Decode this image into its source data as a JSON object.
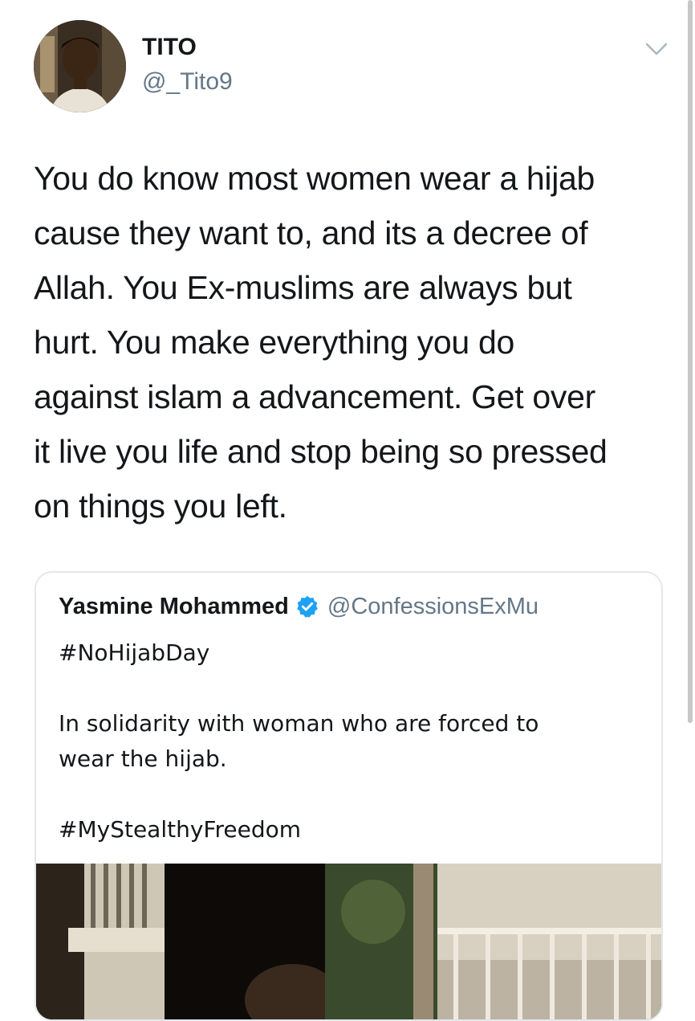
{
  "author": {
    "name": "TITO",
    "handle": "@_Tito9",
    "avatar_icon": "profile-photo"
  },
  "tweet": {
    "lines": [
      "You do know most women wear a hijab",
      "cause they want to, and its a decree of",
      "Allah. You Ex-muslims are always but",
      "hurt. You make everything you do",
      "against islam a advancement. Get over",
      "it live you life and stop being so pressed",
      "on things you left."
    ]
  },
  "quoted_tweet": {
    "name": "Yasmine Mohammed",
    "handle": "@ConfessionsExMu",
    "verified": true,
    "hashtag_top": "#NoHijabDay",
    "body_line1": "In solidarity with woman who are forced to",
    "body_line2": "wear the hijab.",
    "hashtag_bottom": "#MyStealthyFreedom",
    "media_icon": "video-thumbnail"
  },
  "colors": {
    "text_primary": "#14171a",
    "text_secondary": "#657786",
    "verified_blue": "#1da1f2",
    "border": "#e1e8ed"
  },
  "icons": {
    "menu": "chevron-down-icon",
    "verified": "verified-badge-icon"
  }
}
